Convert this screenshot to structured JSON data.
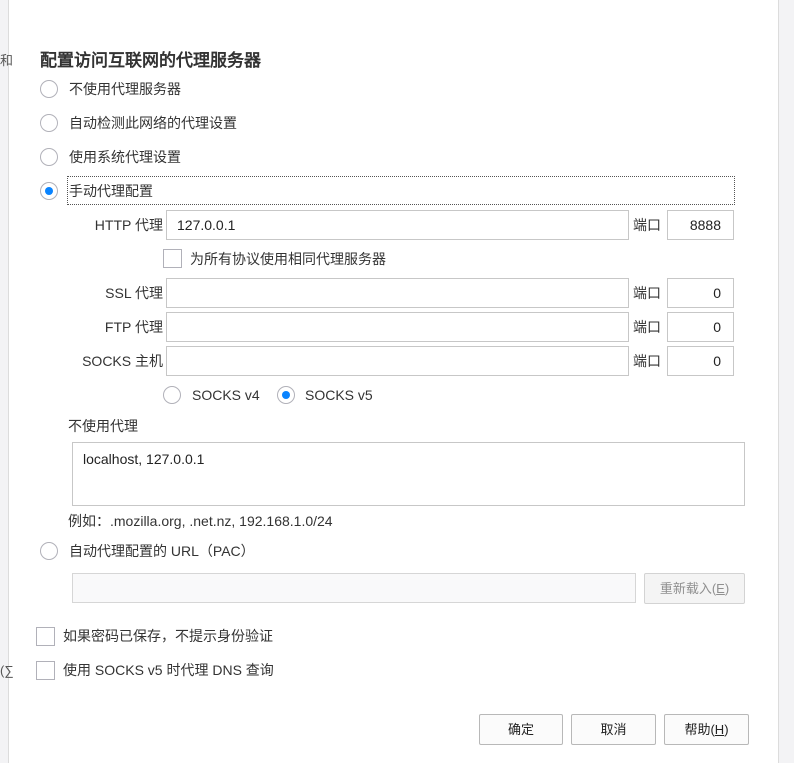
{
  "background": {
    "fragment_top": "和",
    "fragment_mid": "(∑"
  },
  "dialog": {
    "title": "配置访问互联网的代理服务器",
    "radios": {
      "no_proxy": "不使用代理服务器",
      "auto_detect": "自动检测此网络的代理设置",
      "system": "使用系统代理设置",
      "manual": "手动代理配置",
      "pac": "自动代理配置的 URL（PAC）"
    },
    "selected_mode": "manual",
    "http": {
      "label": "HTTP 代理",
      "value": "127.0.0.1",
      "port_label": "端口",
      "port": "8888"
    },
    "same_proxy_label": "为所有协议使用相同代理服务器",
    "ssl": {
      "label": "SSL 代理",
      "value": "",
      "port_label": "端口",
      "port": "0"
    },
    "ftp": {
      "label": "FTP 代理",
      "value": "",
      "port_label": "端口",
      "port": "0"
    },
    "socks": {
      "label": "SOCKS 主机",
      "value": "",
      "port_label": "端口",
      "port": "0"
    },
    "socks_v4": "SOCKS v4",
    "socks_v5": "SOCKS v5",
    "socks_selected": "v5",
    "no_proxy_for_label": "不使用代理",
    "no_proxy_for_value": "localhost, 127.0.0.1",
    "example": "例如：.mozilla.org, .net.nz, 192.168.1.0/24",
    "pac_url": "",
    "reload_label": "重新载入(",
    "reload_key": "E",
    "reload_close": ")",
    "no_prompt_auth": "如果密码已保存，不提示身份验证",
    "socks_dns": "使用 SOCKS v5 时代理 DNS 查询",
    "ok_label": "确定",
    "cancel_label": "取消",
    "help_label": "帮助(",
    "help_key": "H",
    "help_close": ")"
  },
  "colors": {
    "accent": "#0a84ff",
    "border": "#c7c7c7",
    "text": "#333333"
  }
}
